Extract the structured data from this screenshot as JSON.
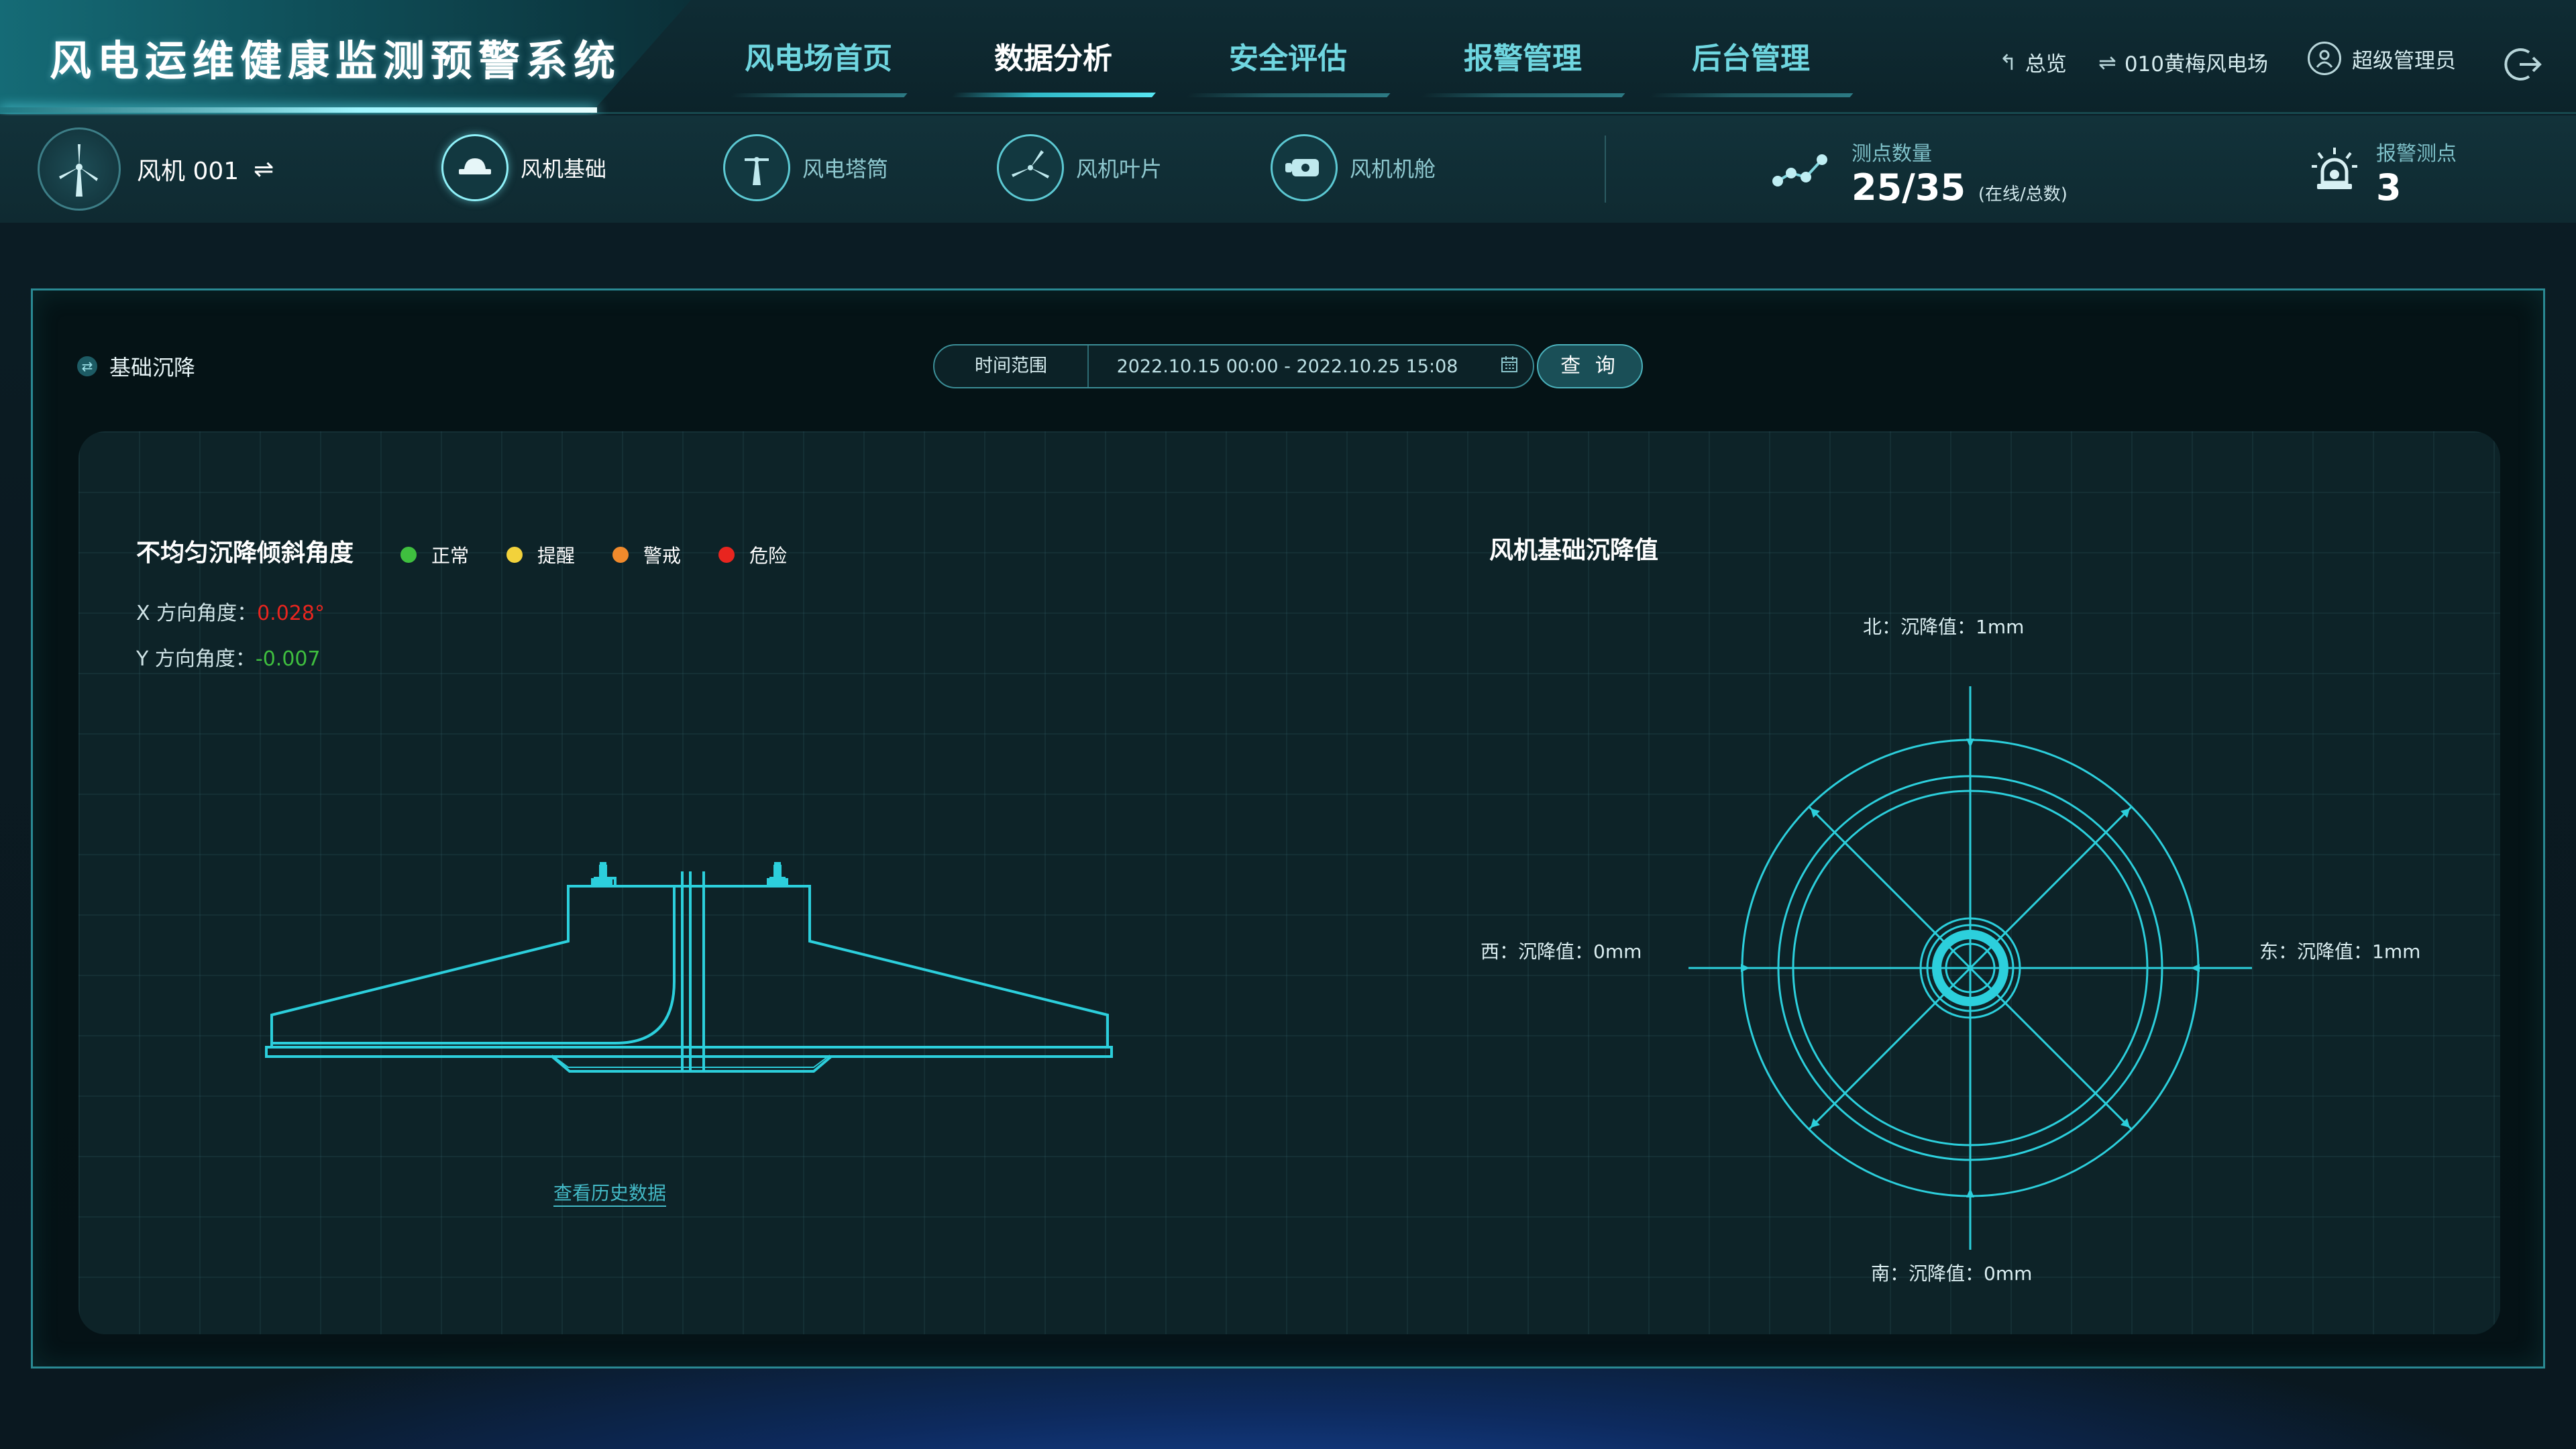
{
  "app": {
    "title": "风电运维健康监测预警系统"
  },
  "nav": {
    "tabs": [
      {
        "label": "风电场首页",
        "active": false
      },
      {
        "label": "数据分析",
        "active": true
      },
      {
        "label": "安全评估",
        "active": false
      },
      {
        "label": "报警管理",
        "active": false
      },
      {
        "label": "后台管理",
        "active": false
      }
    ],
    "overview_label": "总览",
    "farm_label": "010黄梅风电场",
    "user_label": "超级管理员"
  },
  "subnav": {
    "turbine_name": "风机 001",
    "parts": [
      {
        "label": "风机基础",
        "icon": "foundation-icon",
        "active": true
      },
      {
        "label": "风电塔筒",
        "icon": "tower-icon",
        "active": false
      },
      {
        "label": "风机叶片",
        "icon": "blade-icon",
        "active": false
      },
      {
        "label": "风机机舱",
        "icon": "nacelle-icon",
        "active": false
      }
    ],
    "points": {
      "label": "测点数量",
      "value": "25/35",
      "sub": "(在线/总数)"
    },
    "alarm": {
      "label": "报警测点",
      "value": "3"
    }
  },
  "panel": {
    "title": "基础沉降",
    "time_range_label": "时间范围",
    "time_range_value": "2022.10.15 00:00 - 2022.10.25 15:08",
    "query_label": "查 询"
  },
  "tilt": {
    "title": "不均匀沉降倾斜角度",
    "legend": [
      {
        "label": "正常",
        "color": "#3fbf3f"
      },
      {
        "label": "提醒",
        "color": "#f2d23b"
      },
      {
        "label": "警戒",
        "color": "#f08a2c"
      },
      {
        "label": "危险",
        "color": "#e8251f"
      }
    ],
    "x_label": "X 方向角度：",
    "x_value": "0.028°",
    "x_color": "#e8251f",
    "y_label": "Y 方向角度：",
    "y_value": "-0.007",
    "y_color": "#3fbf3f",
    "history_link": "查看历史数据"
  },
  "settlement": {
    "title": "风机基础沉降值",
    "north": "北：沉降值：1mm",
    "south": "南：沉降值：0mm",
    "east": "东：沉降值：1mm",
    "west": "西：沉降值：0mm"
  },
  "colors": {
    "accent": "#39d8e6",
    "line": "#2ccfdc"
  }
}
